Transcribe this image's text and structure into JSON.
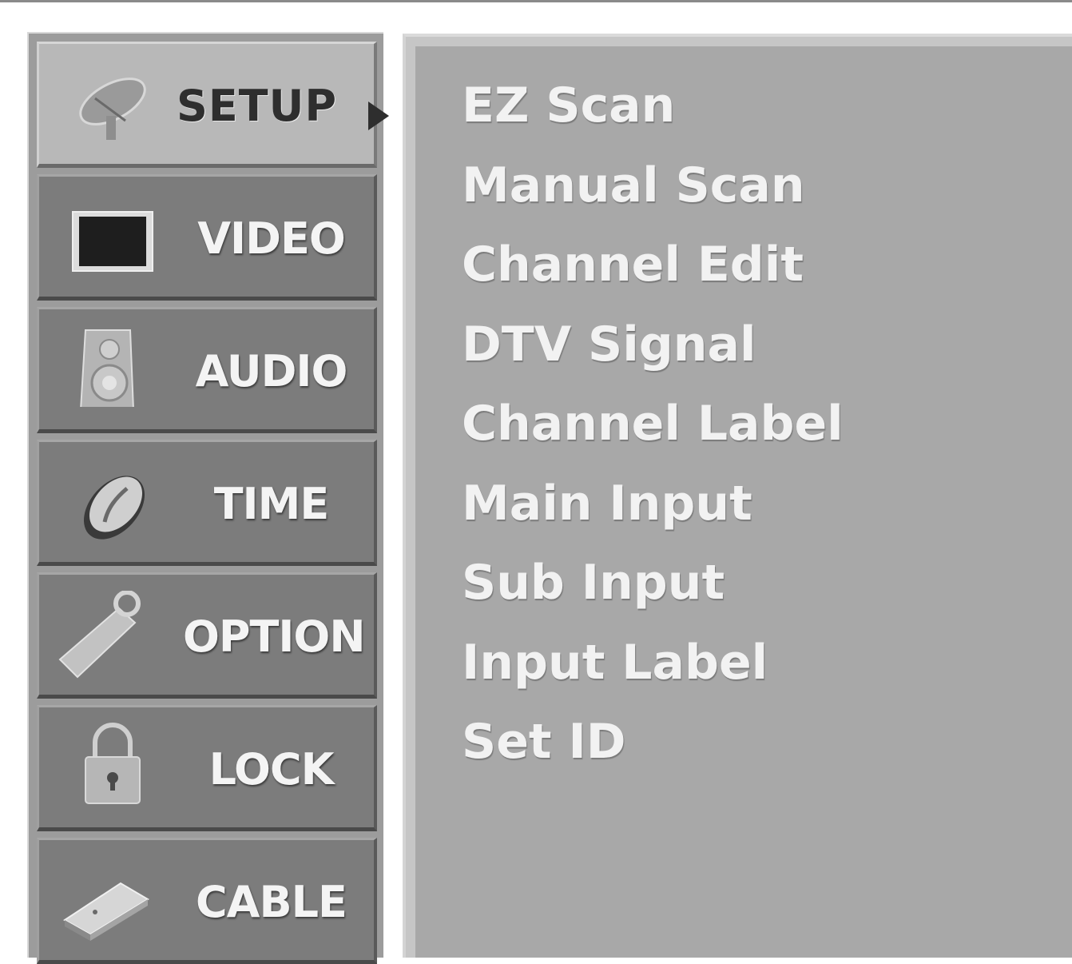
{
  "menu": {
    "categories": [
      {
        "label": "SETUP",
        "icon": "satellite-dish-icon",
        "active": true
      },
      {
        "label": "VIDEO",
        "icon": "monitor-icon",
        "active": false
      },
      {
        "label": "AUDIO",
        "icon": "speaker-icon",
        "active": false
      },
      {
        "label": "TIME",
        "icon": "clock-icon",
        "active": false
      },
      {
        "label": "OPTION",
        "icon": "remote-control-icon",
        "active": false
      },
      {
        "label": "LOCK",
        "icon": "padlock-icon",
        "active": false
      },
      {
        "label": "CABLE",
        "icon": "cable-card-icon",
        "active": false
      }
    ],
    "submenu": {
      "items": [
        "EZ Scan",
        "Manual Scan",
        "Channel Edit",
        "DTV Signal",
        "Channel Label",
        "Main Input",
        "Sub Input",
        "Input Label",
        "Set ID"
      ]
    }
  },
  "colors": {
    "panel_bg": "#a8a8a8",
    "category_bg": "#7c7c7c",
    "active_category_bg": "#b8b8b8",
    "text_light": "#f2f2f2",
    "text_dark": "#2e2e2e"
  }
}
